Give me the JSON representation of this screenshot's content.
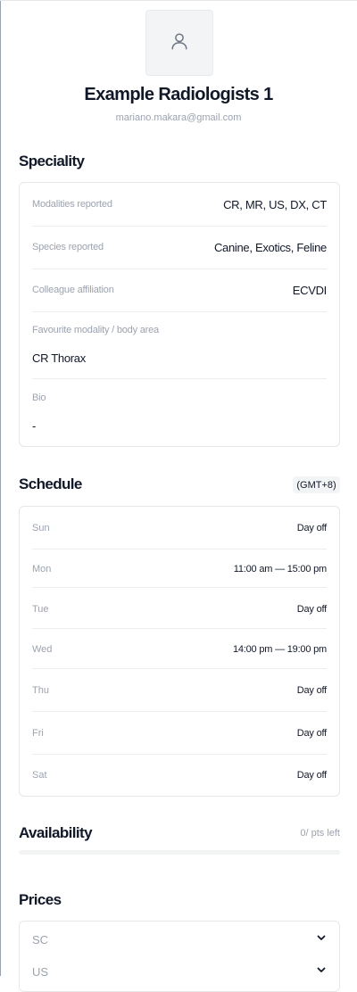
{
  "profile": {
    "name": "Example Radiologists 1",
    "email": "mariano.makara@gmail.com",
    "avatar_icon": "user-icon"
  },
  "speciality": {
    "title": "Speciality",
    "modalities": {
      "label": "Modalities reported",
      "value": "CR, MR, US, DX, CT"
    },
    "species": {
      "label": "Species reported",
      "value": "Canine, Exotics, Feline"
    },
    "affiliation": {
      "label": "Colleague affiliation",
      "value": "ECVDI"
    },
    "favourite": {
      "label": "Favourite modality / body area",
      "value": "CR Thorax"
    },
    "bio": {
      "label": "Bio",
      "value": "-"
    }
  },
  "schedule": {
    "title": "Schedule",
    "timezone": "(GMT+8)",
    "days": [
      {
        "day": "Sun",
        "value": "Day off"
      },
      {
        "day": "Mon",
        "value": "11:00 am — 15:00 pm"
      },
      {
        "day": "Tue",
        "value": "Day off"
      },
      {
        "day": "Wed",
        "value": "14:00 pm — 19:00 pm"
      },
      {
        "day": "Thu",
        "value": "Day off"
      },
      {
        "day": "Fri",
        "value": "Day off"
      },
      {
        "day": "Sat",
        "value": "Day off"
      }
    ]
  },
  "availability": {
    "title": "Availability",
    "meta": "0/ pts left",
    "progress_fraction": 0
  },
  "prices": {
    "title": "Prices",
    "items": [
      {
        "label": "SC",
        "icon": "chevron-down-icon"
      },
      {
        "label": "US",
        "icon": "chevron-down-icon"
      }
    ]
  }
}
